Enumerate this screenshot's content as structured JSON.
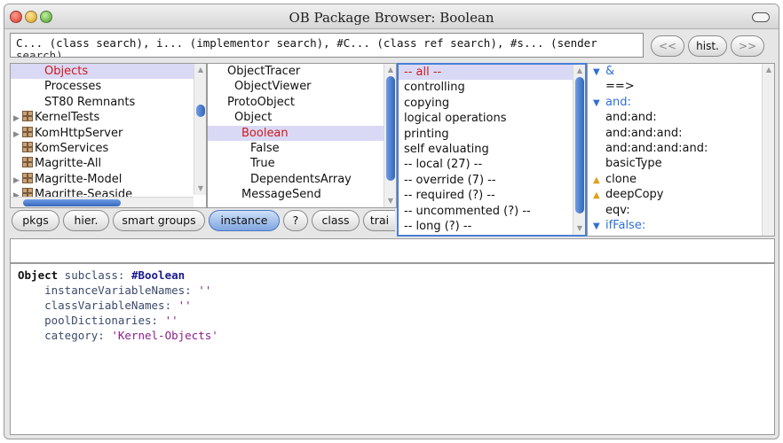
{
  "window": {
    "title": "OB Package Browser: Boolean"
  },
  "search": {
    "value": "C... (class search), i... (implementor search), #C... (class ref search), #s... (sender",
    "wrap_text": "search)"
  },
  "nav": {
    "back": "<<",
    "history": "hist.",
    "forward": ">>"
  },
  "packages": {
    "items": [
      {
        "label": "Objects",
        "selected": true,
        "icon": "none"
      },
      {
        "label": "Processes",
        "icon": "none"
      },
      {
        "label": "ST80 Remnants",
        "icon": "none"
      },
      {
        "label": "KernelTests",
        "icon": "package-icon",
        "expandable": true
      },
      {
        "label": "KomHttpServer",
        "icon": "package-icon",
        "expandable": true
      },
      {
        "label": "KomServices",
        "icon": "package-icon"
      },
      {
        "label": "Magritte-All",
        "icon": "package-icon"
      },
      {
        "label": "Magritte-Model",
        "icon": "package-icon",
        "expandable": true
      },
      {
        "label": "Magritte-Seaside",
        "icon": "package-icon",
        "expandable": true
      }
    ]
  },
  "classes": {
    "items": [
      {
        "label": "ObjectTracer",
        "indent": 1
      },
      {
        "label": "ObjectViewer",
        "indent": 2
      },
      {
        "label": "ProtoObject",
        "indent": 1
      },
      {
        "label": "Object",
        "indent": 2
      },
      {
        "label": "Boolean",
        "indent": 3,
        "selected": true
      },
      {
        "label": "False",
        "indent": 4
      },
      {
        "label": "True",
        "indent": 4
      },
      {
        "label": "DependentsArray",
        "indent": 4
      },
      {
        "label": "MessageSend",
        "indent": 3
      }
    ]
  },
  "protocols": {
    "items": [
      {
        "label": "-- all --",
        "selected": true
      },
      {
        "label": "controlling"
      },
      {
        "label": "copying"
      },
      {
        "label": "logical operations"
      },
      {
        "label": "printing"
      },
      {
        "label": "self evaluating"
      },
      {
        "label": "-- local (27) --"
      },
      {
        "label": "-- override (7) --"
      },
      {
        "label": "-- required (?) --"
      },
      {
        "label": "-- uncommented (?) --"
      },
      {
        "label": "-- long (?) --"
      }
    ]
  },
  "methods": {
    "items": [
      {
        "label": "&",
        "marker": "down"
      },
      {
        "label": "==>",
        "marker": "none"
      },
      {
        "label": "and:",
        "marker": "down",
        "blue": true
      },
      {
        "label": "and:and:",
        "marker": "none"
      },
      {
        "label": "and:and:and:",
        "marker": "none"
      },
      {
        "label": "and:and:and:and:",
        "marker": "none"
      },
      {
        "label": "basicType",
        "marker": "none"
      },
      {
        "label": "clone",
        "marker": "up"
      },
      {
        "label": "deepCopy",
        "marker": "up"
      },
      {
        "label": "eqv:",
        "marker": "none"
      },
      {
        "label": "ifFalse:",
        "marker": "down",
        "blue": true
      }
    ]
  },
  "buttons": {
    "pkgs": "pkgs",
    "hier": "hier.",
    "smart_groups": "smart groups",
    "instance": "instance",
    "help": "?",
    "class": "class",
    "traits": "trai"
  },
  "code": {
    "line1": {
      "kw": "Object",
      "mid": " subclass: ",
      "sym": "#Boolean"
    },
    "line2": {
      "label": "    instanceVariableNames: ",
      "value": "''"
    },
    "line3": {
      "label": "    classVariableNames: ",
      "value": "''"
    },
    "line4": {
      "label": "    poolDictionaries: ",
      "value": "''"
    },
    "line5": {
      "label": "    category: ",
      "value": "'Kernel-Objects'"
    }
  },
  "colors": {
    "selection_bg": "#d9d9f5",
    "selected_text_red": "#d1191c",
    "focus_border": "#4a7fd4",
    "scroll_thumb": "#3565b8"
  }
}
